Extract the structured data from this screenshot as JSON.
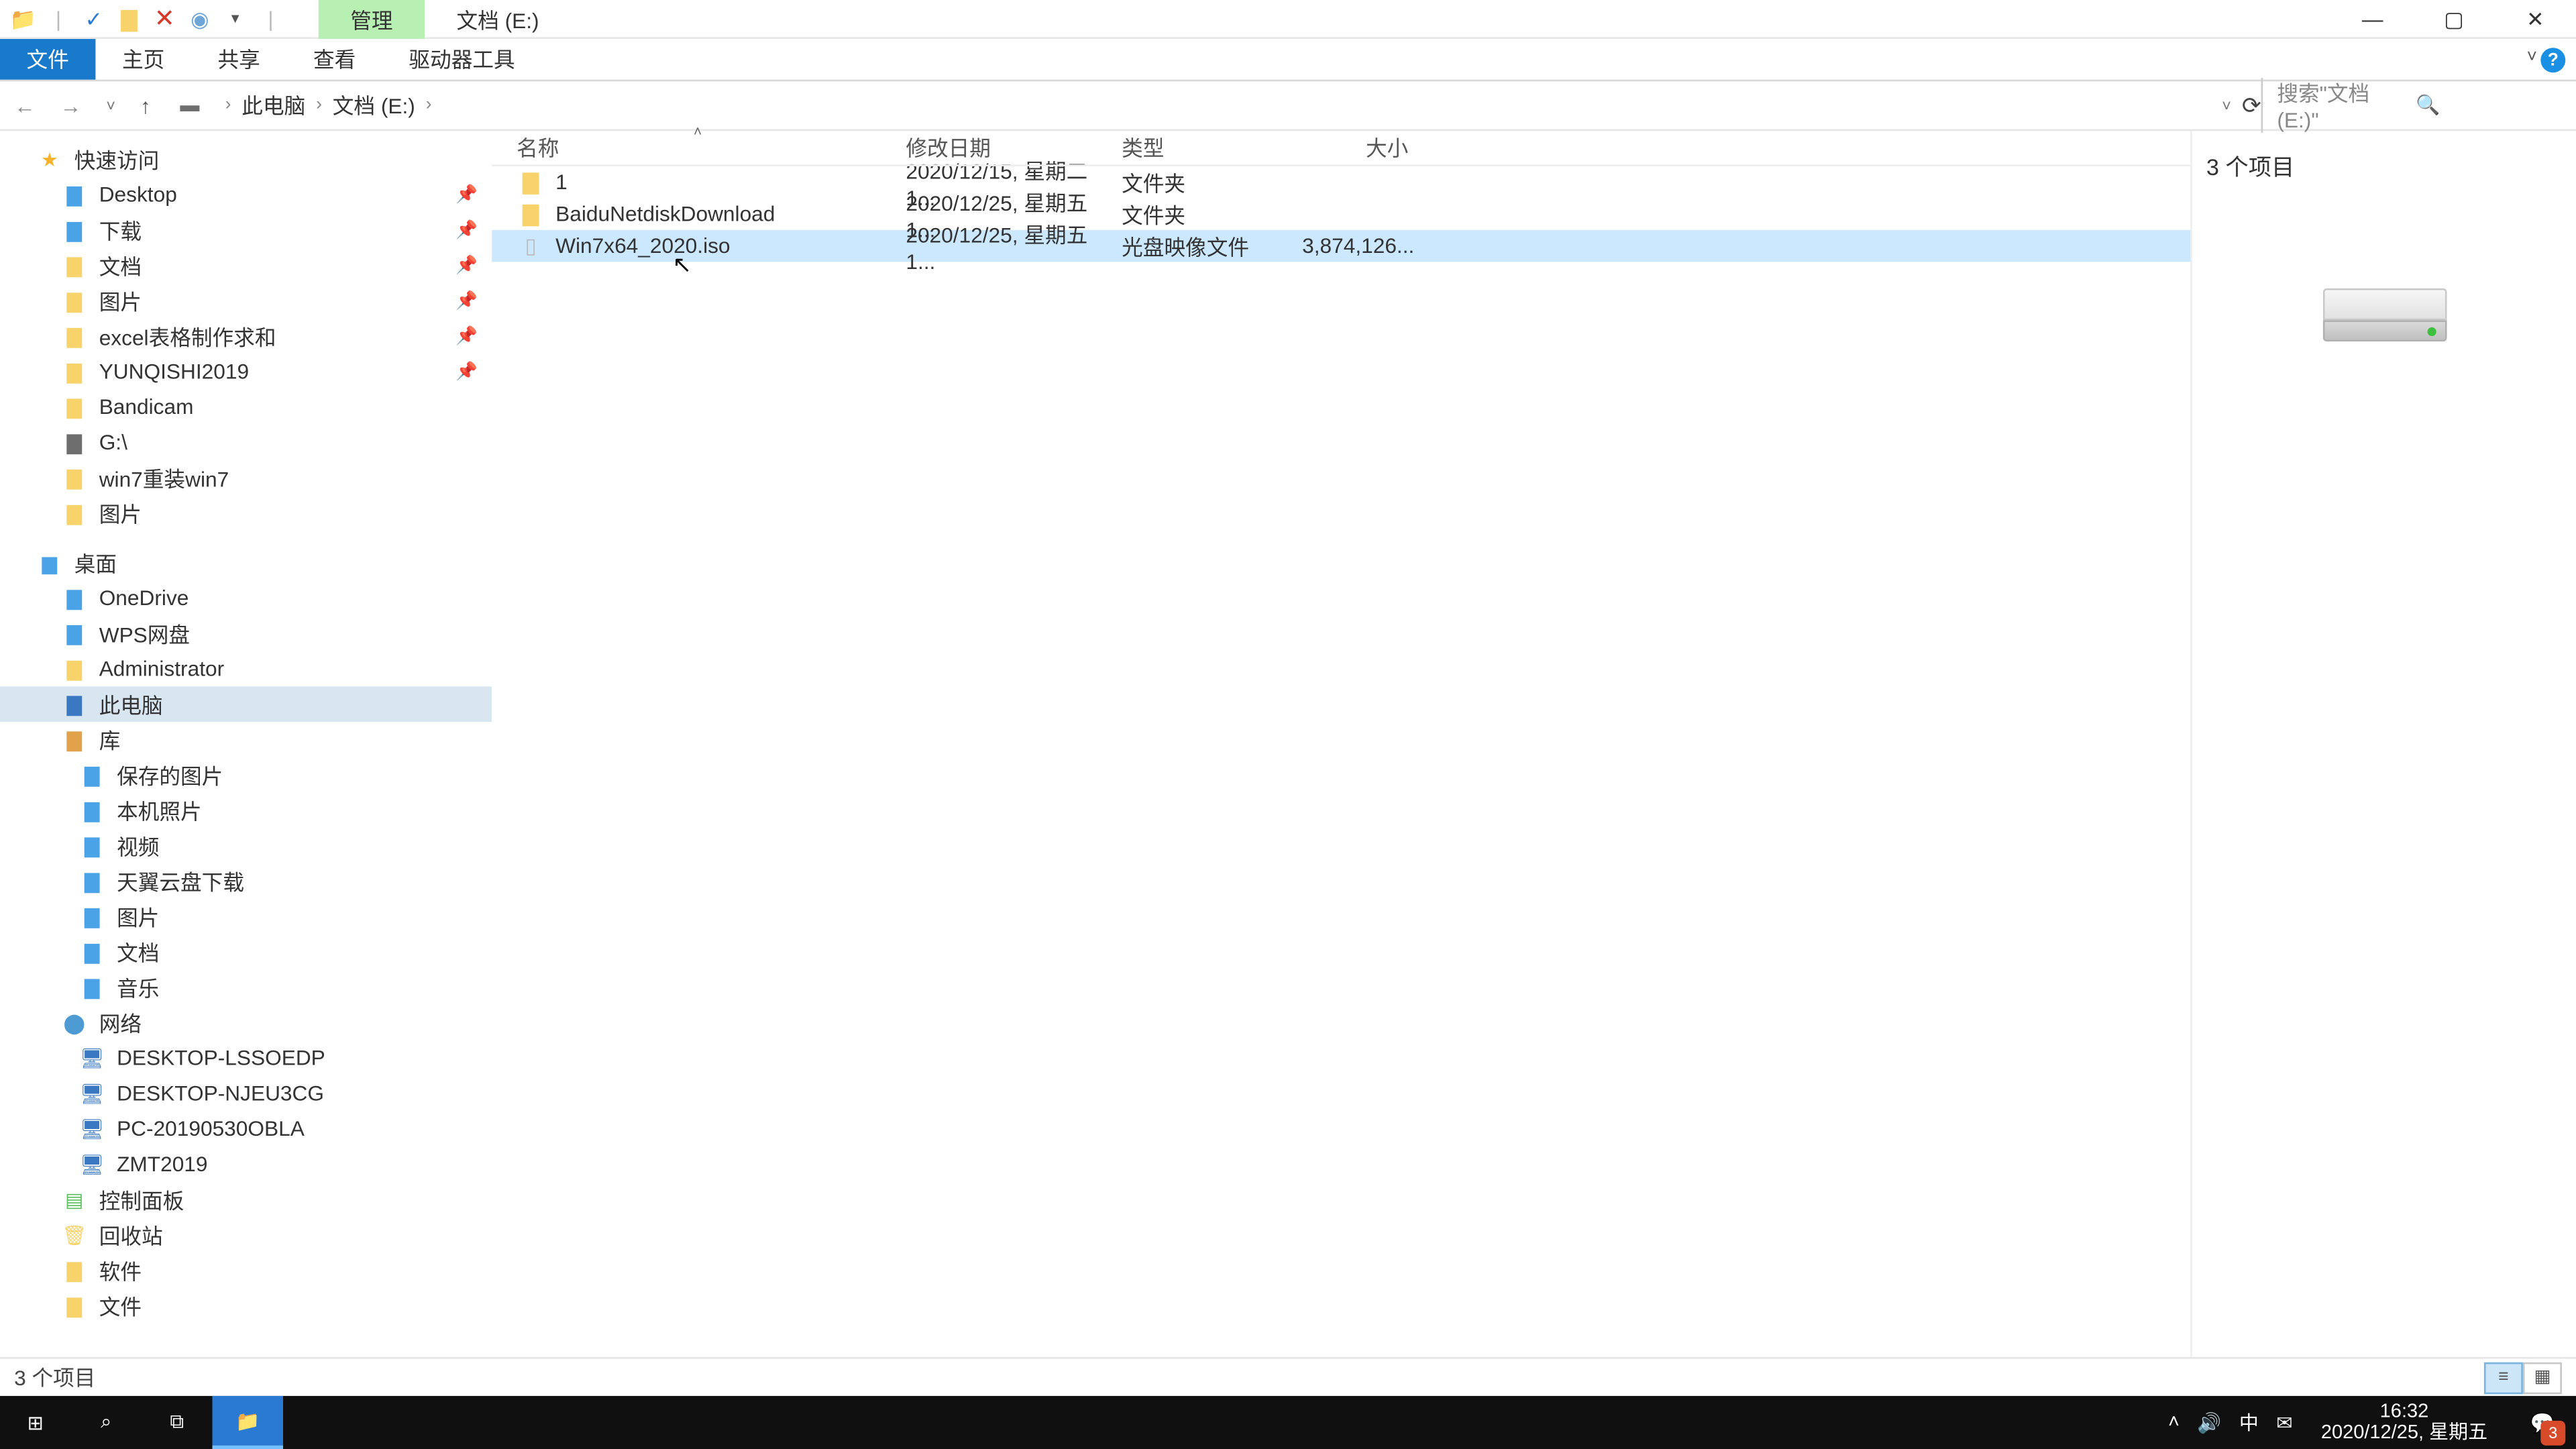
{
  "titlebar": {
    "manage_tab": "管理",
    "location_tab": "文档 (E:)"
  },
  "ribbon": {
    "file": "文件",
    "home": "主页",
    "share": "共享",
    "view": "查看",
    "drive_tools": "驱动器工具"
  },
  "address": {
    "crumbs": [
      "此电脑",
      "文档 (E:)"
    ],
    "search_placeholder": "搜索\"文档 (E:)\""
  },
  "nav": {
    "quick_access": "快速访问",
    "qa_items": [
      {
        "label": "Desktop",
        "icon": "ic-blue",
        "pinned": true
      },
      {
        "label": "下载",
        "icon": "ic-blue",
        "pinned": true
      },
      {
        "label": "文档",
        "icon": "ic-folder",
        "pinned": true
      },
      {
        "label": "图片",
        "icon": "ic-folder",
        "pinned": true
      },
      {
        "label": "excel表格制作求和",
        "icon": "ic-folder",
        "pinned": true
      },
      {
        "label": "YUNQISHI2019",
        "icon": "ic-folder",
        "pinned": true
      },
      {
        "label": "Bandicam",
        "icon": "ic-folder",
        "pinned": false
      },
      {
        "label": "G:\\",
        "icon": "ic-drive",
        "pinned": false
      },
      {
        "label": "win7重装win7",
        "icon": "ic-folder",
        "pinned": false
      },
      {
        "label": "图片",
        "icon": "ic-folder",
        "pinned": false
      }
    ],
    "desktop": "桌面",
    "desk_items": [
      {
        "label": "OneDrive",
        "icon": "ic-blue"
      },
      {
        "label": "WPS网盘",
        "icon": "ic-blue"
      },
      {
        "label": "Administrator",
        "icon": "ic-folder"
      },
      {
        "label": "此电脑",
        "icon": "ic-pc",
        "selected": true
      },
      {
        "label": "库",
        "icon": "ic-lib"
      }
    ],
    "lib_items": [
      {
        "label": "保存的图片",
        "icon": "ic-blue"
      },
      {
        "label": "本机照片",
        "icon": "ic-blue"
      },
      {
        "label": "视频",
        "icon": "ic-blue"
      },
      {
        "label": "天翼云盘下载",
        "icon": "ic-blue"
      },
      {
        "label": "图片",
        "icon": "ic-blue"
      },
      {
        "label": "文档",
        "icon": "ic-blue"
      },
      {
        "label": "音乐",
        "icon": "ic-blue"
      }
    ],
    "network": "网络",
    "net_items": [
      {
        "label": "DESKTOP-LSSOEDP",
        "icon": "ic-pc"
      },
      {
        "label": "DESKTOP-NJEU3CG",
        "icon": "ic-pc"
      },
      {
        "label": "PC-20190530OBLA",
        "icon": "ic-pc"
      },
      {
        "label": "ZMT2019",
        "icon": "ic-pc"
      }
    ],
    "control_panel": "控制面板",
    "recycle": "回收站",
    "software": "软件",
    "docs": "文件"
  },
  "columns": {
    "name": "名称",
    "date": "修改日期",
    "type": "类型",
    "size": "大小"
  },
  "files": [
    {
      "name": "1",
      "date": "2020/12/15, 星期二 1...",
      "type": "文件夹",
      "size": "",
      "icon": "fold-ic"
    },
    {
      "name": "BaiduNetdiskDownload",
      "date": "2020/12/25, 星期五 1...",
      "type": "文件夹",
      "size": "",
      "icon": "fold-ic"
    },
    {
      "name": "Win7x64_2020.iso",
      "date": "2020/12/25, 星期五 1...",
      "type": "光盘映像文件",
      "size": "3,874,126...",
      "icon": "file-ic",
      "selected": true
    }
  ],
  "preview": {
    "title": "3 个项目"
  },
  "status": {
    "text": "3 个项目"
  },
  "taskbar": {
    "time": "16:32",
    "date": "2020/12/25, 星期五",
    "ime": "中",
    "notif_count": "3"
  }
}
